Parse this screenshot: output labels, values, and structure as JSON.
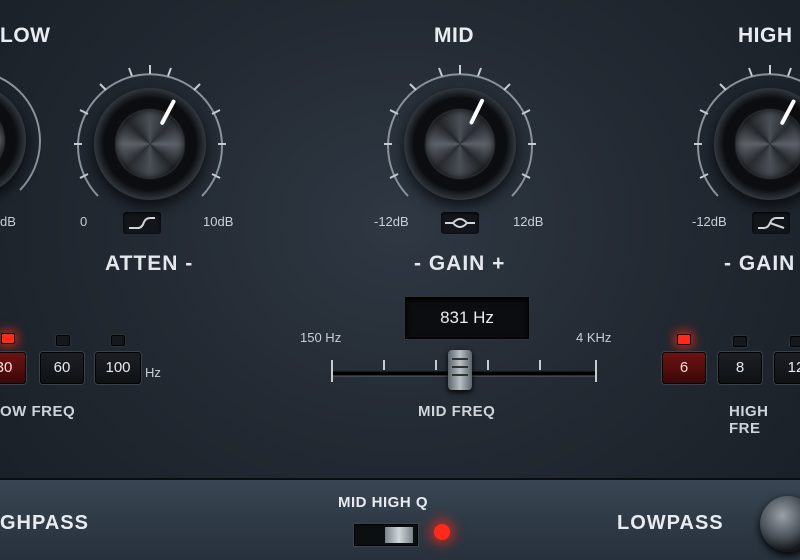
{
  "sections": {
    "low": {
      "title": "LOW"
    },
    "mid": {
      "title": "MID"
    },
    "high": {
      "title": "HIGH"
    }
  },
  "knobs": {
    "low_boost": {
      "scale_max": "dB"
    },
    "low_atten": {
      "scale_min": "0",
      "scale_max": "10dB",
      "name": "ATTEN -",
      "level": 0.72
    },
    "mid_gain": {
      "scale_min": "-12dB",
      "scale_max": "12dB",
      "name": "- GAIN +",
      "level": 0.7
    },
    "high_gain": {
      "scale_min": "-12dB",
      "name": "- GAIN",
      "level": 0.7
    }
  },
  "low_freq": {
    "buttons": [
      "30",
      "60",
      "100"
    ],
    "selected": "30",
    "unit": "Hz",
    "label": "OW FREQ"
  },
  "mid_freq": {
    "display": "831 Hz",
    "min_label": "150 Hz",
    "max_label": "4 KHz",
    "label": "MID FREQ",
    "level": 0.45
  },
  "high_freq": {
    "buttons": [
      "6",
      "8",
      "12"
    ],
    "selected": "6",
    "label": "HIGH FRE"
  },
  "bottom": {
    "highpass_label": "GHPASS",
    "mid_high_q_label": "MID HIGH Q",
    "lowpass_label": "LOWPASS"
  },
  "colors": {
    "led_on": "#ff2a1a",
    "panel": "#232a33",
    "accent_button": "#6e1212"
  }
}
